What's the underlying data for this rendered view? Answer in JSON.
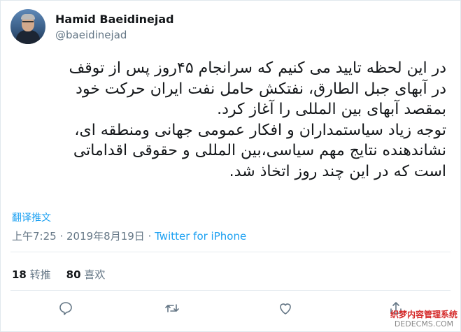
{
  "user": {
    "name": "Hamid Baeidinejad",
    "handle": "@baeidinejad"
  },
  "tweet": {
    "text": "در این لحظه تایید می کنیم که سرانجام ۴۵روز پس از توقف\nدر آبهای جبل الطارق، نفتکش حامل نفت ایران حرکت خود\nبمقصد آبهای بین المللی را آغاز کرد.\nتوجه زیاد سیاستمداران و افکار عمومی جهانی ومنطقه ای،\nنشاندهنده نتایج مهم سیاسی،بین المللی و حقوقی اقداماتی\nاست که در این چند روز اتخاذ شد.",
    "translate_label": "翻译推文",
    "time": "上午7:25",
    "separator": " · ",
    "date": "2019年8月19日",
    "source": "Twitter for iPhone"
  },
  "stats": {
    "retweets_count": "18",
    "retweets_label": "转推",
    "likes_count": "80",
    "likes_label": "喜欢"
  },
  "actions": [
    "reply-icon",
    "retweet-icon",
    "like-icon",
    "share-icon"
  ],
  "watermark": {
    "line1": "织梦内容管理系统",
    "line2": "DEDECMS.COM"
  },
  "colors": {
    "link": "#1da1f2",
    "muted": "#657786",
    "text": "#14171a"
  }
}
